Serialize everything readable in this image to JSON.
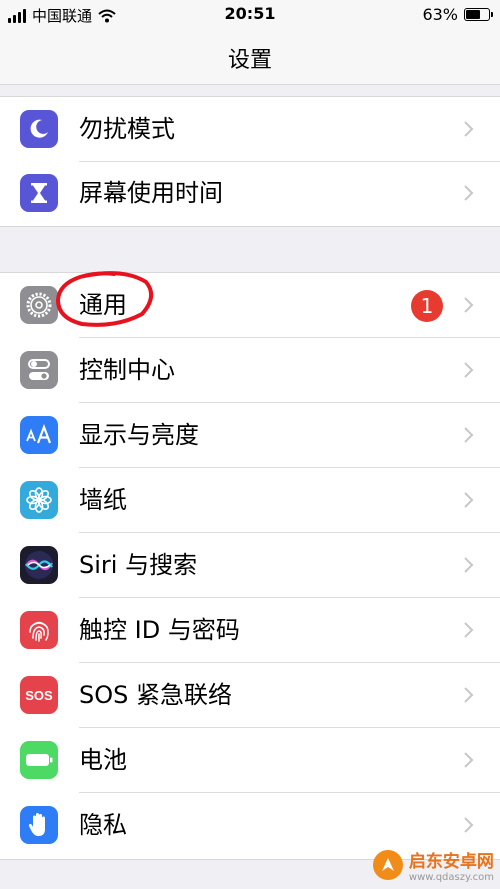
{
  "status_bar": {
    "carrier": "中国联通",
    "time": "20:51",
    "battery_percent_label": "63%",
    "battery_level": 0.63
  },
  "nav": {
    "title": "设置"
  },
  "group1": [
    {
      "label": "勿扰模式",
      "icon": "moon-icon",
      "color": "#5856d6"
    },
    {
      "label": "屏幕使用时间",
      "icon": "hourglass-icon",
      "color": "#5856d6"
    }
  ],
  "group2": [
    {
      "label": "通用",
      "icon": "gear-icon",
      "color": "#8e8e93",
      "badge": "1"
    },
    {
      "label": "控制中心",
      "icon": "toggles-icon",
      "color": "#8e8e93"
    },
    {
      "label": "显示与亮度",
      "icon": "text-size-icon",
      "color": "#2e7cf6"
    },
    {
      "label": "墙纸",
      "icon": "flower-icon",
      "color": "#34aadc"
    },
    {
      "label": "Siri 与搜索",
      "icon": "siri-icon",
      "color": "#1c1c2e"
    },
    {
      "label": "触控 ID 与密码",
      "icon": "fingerprint-icon",
      "color": "#e5434b"
    },
    {
      "label": "SOS 紧急联络",
      "icon": "sos-icon",
      "color": "#e5434b",
      "icon_text": "SOS"
    },
    {
      "label": "电池",
      "icon": "battery-icon",
      "color": "#4cd964"
    },
    {
      "label": "隐私",
      "icon": "hand-icon",
      "color": "#2e7cf6"
    }
  ],
  "watermark": {
    "title": "启东安卓网",
    "url": "www.qdaszy.com"
  },
  "annotation_color": "#e8121f"
}
